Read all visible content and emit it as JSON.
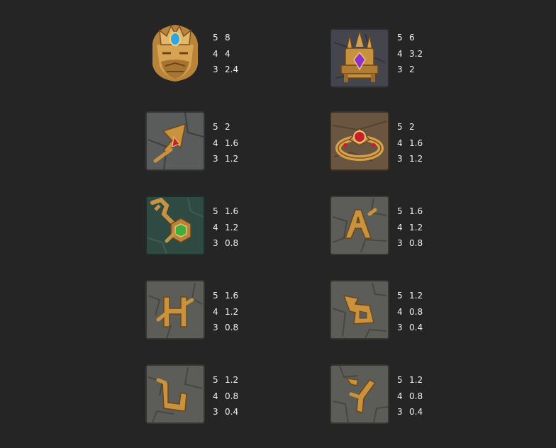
{
  "paytable": {
    "symbols": [
      {
        "icon": "king-icon",
        "pays": [
          {
            "count": "5",
            "value": "8"
          },
          {
            "count": "4",
            "value": "4"
          },
          {
            "count": "3",
            "value": "2.4"
          }
        ]
      },
      {
        "icon": "throne-icon",
        "pays": [
          {
            "count": "5",
            "value": "6"
          },
          {
            "count": "4",
            "value": "3.2"
          },
          {
            "count": "3",
            "value": "2"
          }
        ]
      },
      {
        "icon": "trident-icon",
        "pays": [
          {
            "count": "5",
            "value": "2"
          },
          {
            "count": "4",
            "value": "1.6"
          },
          {
            "count": "3",
            "value": "1.2"
          }
        ]
      },
      {
        "icon": "ring-icon",
        "pays": [
          {
            "count": "5",
            "value": "2"
          },
          {
            "count": "4",
            "value": "1.6"
          },
          {
            "count": "3",
            "value": "1.2"
          }
        ]
      },
      {
        "icon": "key-icon",
        "pays": [
          {
            "count": "5",
            "value": "1.6"
          },
          {
            "count": "4",
            "value": "1.2"
          },
          {
            "count": "3",
            "value": "0.8"
          }
        ]
      },
      {
        "icon": "rune-a-icon",
        "pays": [
          {
            "count": "5",
            "value": "1.6"
          },
          {
            "count": "4",
            "value": "1.2"
          },
          {
            "count": "3",
            "value": "0.8"
          }
        ]
      },
      {
        "icon": "rune-h-icon",
        "pays": [
          {
            "count": "5",
            "value": "1.6"
          },
          {
            "count": "4",
            "value": "1.2"
          },
          {
            "count": "3",
            "value": "0.8"
          }
        ]
      },
      {
        "icon": "rune-d-icon",
        "pays": [
          {
            "count": "5",
            "value": "1.2"
          },
          {
            "count": "4",
            "value": "0.8"
          },
          {
            "count": "3",
            "value": "0.4"
          }
        ]
      },
      {
        "icon": "rune-u-icon",
        "pays": [
          {
            "count": "5",
            "value": "1.2"
          },
          {
            "count": "4",
            "value": "0.8"
          },
          {
            "count": "3",
            "value": "0.4"
          }
        ]
      },
      {
        "icon": "rune-y-icon",
        "pays": [
          {
            "count": "5",
            "value": "1.2"
          },
          {
            "count": "4",
            "value": "0.8"
          },
          {
            "count": "3",
            "value": "0.4"
          }
        ]
      }
    ]
  },
  "colors": {
    "background": "#252525",
    "text": "#f0f0f0",
    "gold": "#c8923f",
    "stone": "#5c5d58"
  }
}
